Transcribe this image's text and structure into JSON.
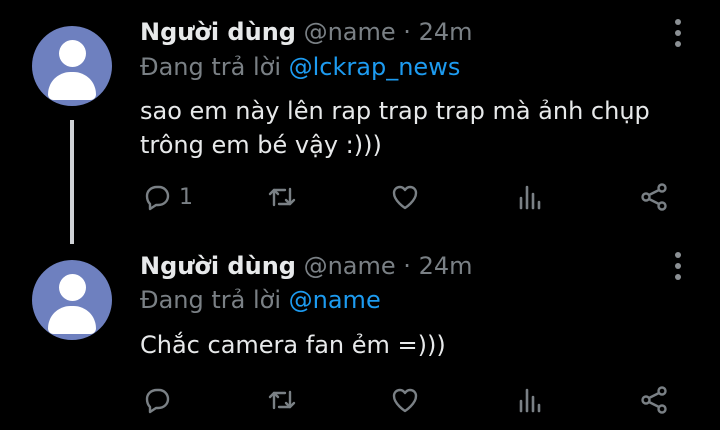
{
  "colors": {
    "background": "#000000",
    "text": "#e7e9ea",
    "muted": "#7a8085",
    "link": "#1d9bf0",
    "avatar": "#6e80bf"
  },
  "tweets": [
    {
      "name": "Người dùng",
      "handle": "@name",
      "dot": "·",
      "time": "24m",
      "reply_prefix": "Đang trả lời ",
      "reply_to": "@lckrap_news",
      "text": "sao em này lên rap trap trap mà ảnh chụp trông em bé vậy :)))",
      "reply_count": "1"
    },
    {
      "name": "Người dùng",
      "handle": "@name",
      "dot": "·",
      "time": "24m",
      "reply_prefix": "Đang trả lời ",
      "reply_to": "@name",
      "text": "Chắc camera fan ẻm =)))",
      "reply_count": ""
    }
  ],
  "icons": [
    "avatar-icon",
    "more-icon",
    "reply-icon",
    "retweet-icon",
    "like-icon",
    "views-icon",
    "share-icon"
  ]
}
